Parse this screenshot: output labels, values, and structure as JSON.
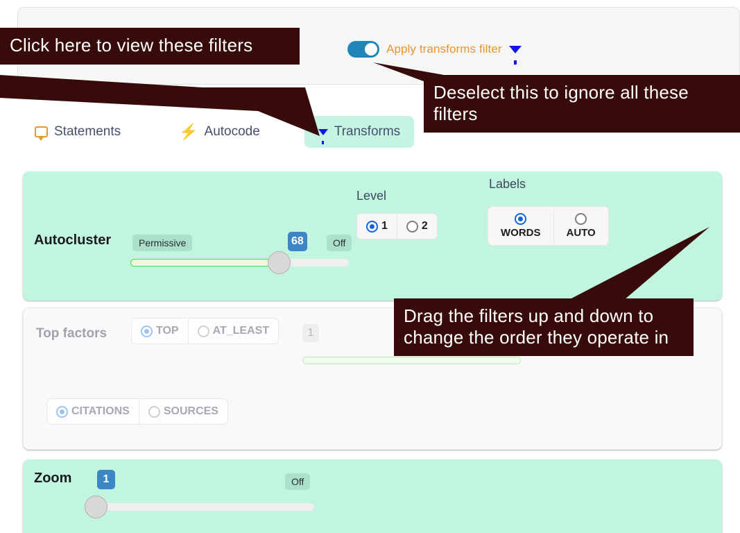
{
  "header": {
    "toggle_label": "Apply transforms filter",
    "toggle_state": "on",
    "funnel_icon": "funnel-filter-icon",
    "accent_color": "#1f86b8",
    "label_color": "#e8962e",
    "funnel_color": "#1414e6"
  },
  "tabs": [
    {
      "label": "Statements",
      "icon": "speech-bubble-icon",
      "active": false
    },
    {
      "label": "Autocode",
      "icon": "lightning-bolt-icon",
      "active": false
    },
    {
      "label": "Transforms",
      "icon": "funnel-filter-icon",
      "active": true
    }
  ],
  "filters": {
    "autocluster": {
      "name": "Autocluster",
      "mode_tag": "Permissive",
      "slider_value": "68",
      "slider_percent": 68,
      "off_tag": "Off",
      "level": {
        "title": "Level",
        "options": [
          {
            "label": "1",
            "selected": true
          },
          {
            "label": "2",
            "selected": false
          }
        ]
      },
      "labels": {
        "title": "Labels",
        "options": [
          {
            "label": "WORDS",
            "selected": true
          },
          {
            "label": "AUTO",
            "selected": false
          }
        ]
      }
    },
    "top_factors": {
      "name": "Top factors",
      "disabled": true,
      "mode_options": [
        {
          "label": "TOP",
          "selected": true
        },
        {
          "label": "AT_LEAST",
          "selected": false
        }
      ],
      "slider_value": "1",
      "slider_percent": 0,
      "source_options": [
        {
          "label": "CITATIONS",
          "selected": true
        },
        {
          "label": "SOURCES",
          "selected": false
        }
      ]
    },
    "zoom": {
      "name": "Zoom",
      "slider_value": "1",
      "slider_percent": 0,
      "off_tag": "Off"
    }
  },
  "callouts": {
    "one": "Click here to view these filters",
    "two": "Deselect this to ignore all these filters",
    "three": "Drag the filters up and down to change the order they operate in",
    "color": "#380b0b"
  }
}
